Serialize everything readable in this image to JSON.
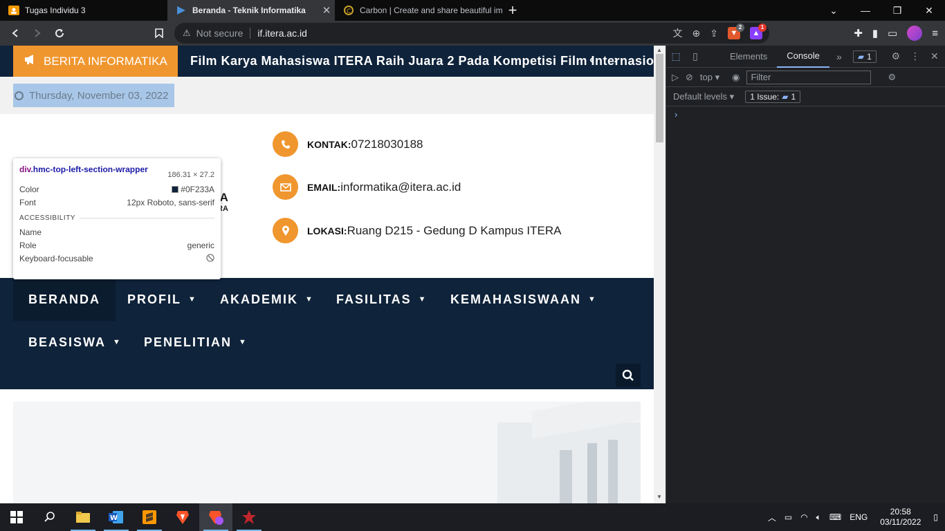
{
  "browser": {
    "tabs": [
      {
        "title": "Tugas Individu 3",
        "active": false
      },
      {
        "title": "Beranda - Teknik Informatika",
        "active": true
      },
      {
        "title": "Carbon | Create and share beautiful im",
        "active": false
      }
    ],
    "security_label": "Not secure",
    "url": "if.itera.ac.id",
    "brave_badge": "2",
    "alert_badge": "1"
  },
  "page": {
    "ticker_label": "BERITA INFORMATIKA",
    "ticker_text": "Film Karya Mahasiswa ITERA Raih Juara 2 Pada Kompetisi Film Internasional",
    "date": "Thursday, November 03, 2022",
    "logo_fragment_1": "IKA",
    "logo_fragment_2": "TERA",
    "contacts": [
      {
        "label": "KONTAK:",
        "value": "07218030188",
        "icon": "phone-icon"
      },
      {
        "label": "EMAIL:",
        "value": "informatika@itera.ac.id",
        "icon": "envelope-icon"
      },
      {
        "label": "LOKASI:",
        "value": "Ruang D215 - Gedung D Kampus ITERA",
        "icon": "map-pin-icon"
      }
    ],
    "nav": [
      "BERANDA",
      "PROFIL",
      "AKADEMIK",
      "FASILITAS",
      "KEMAHASISWAAN",
      "BEASISWA",
      "PENELITIAN"
    ]
  },
  "inspector_tooltip": {
    "selector_tag": "div",
    "selector_class": ".hmc-top-left-section-wrapper",
    "dimensions": "186.31 × 27.2",
    "color_label": "Color",
    "color_value": "#0F233A",
    "font_label": "Font",
    "font_value": "12px Roboto, sans-serif",
    "accessibility_heading": "ACCESSIBILITY",
    "name_label": "Name",
    "role_label": "Role",
    "role_value": "generic",
    "focus_label": "Keyboard-focusable"
  },
  "devtools": {
    "tabs": [
      "Elements",
      "Console"
    ],
    "active_tab": "Console",
    "issues_count": "1",
    "context": "top",
    "filter_placeholder": "Filter",
    "levels": "Default levels",
    "issue_text": "1 Issue:",
    "issue_num": "1",
    "prompt": "›"
  },
  "taskbar": {
    "language": "ENG",
    "time": "20:58",
    "date": "03/11/2022"
  },
  "colors": {
    "navy": "#0f233a",
    "orange": "#f0962e"
  }
}
